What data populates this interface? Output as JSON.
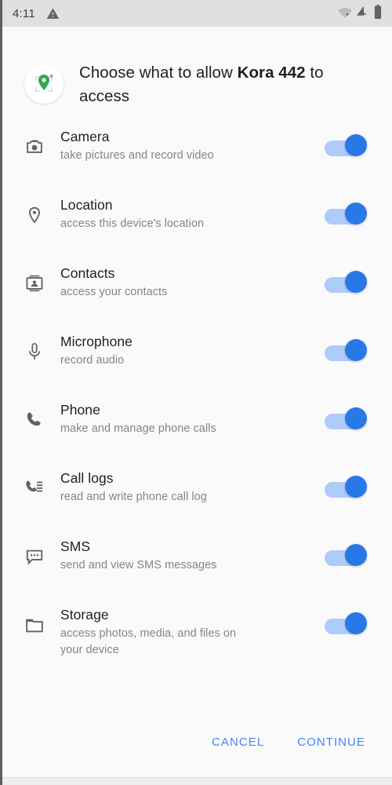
{
  "status_bar": {
    "time": "4:11",
    "warning_icon": "warning-triangle-icon",
    "wifi_icon": "wifi-disconnected-icon",
    "cellular_icon": "cellular-signal-no-sim-icon",
    "battery_icon": "battery-full-icon"
  },
  "header": {
    "app_icon": "location-scanner-app-icon",
    "title_prefix": "Choose what to allow ",
    "app_name": "Kora 442",
    "title_suffix": " to access"
  },
  "permissions": [
    {
      "icon": "camera-icon",
      "title": "Camera",
      "description": "take pictures and record video",
      "enabled": true
    },
    {
      "icon": "location-pin-icon",
      "title": "Location",
      "description": "access this device's location",
      "enabled": true
    },
    {
      "icon": "contacts-icon",
      "title": "Contacts",
      "description": "access your contacts",
      "enabled": true
    },
    {
      "icon": "microphone-icon",
      "title": "Microphone",
      "description": "record audio",
      "enabled": true
    },
    {
      "icon": "phone-icon",
      "title": "Phone",
      "description": "make and manage phone calls",
      "enabled": true
    },
    {
      "icon": "call-logs-icon",
      "title": "Call logs",
      "description": "read and write phone call log",
      "enabled": true
    },
    {
      "icon": "sms-icon",
      "title": "SMS",
      "description": "send and view SMS messages",
      "enabled": true
    },
    {
      "icon": "folder-icon",
      "title": "Storage",
      "description": "access photos, media, and files on your device",
      "enabled": true
    }
  ],
  "actions": {
    "cancel_label": "CANCEL",
    "continue_label": "CONTINUE"
  },
  "colors": {
    "accent": "#4285f4",
    "toggle_thumb": "#2878e8",
    "toggle_track": "#aecbfa",
    "title_text": "#202124",
    "description_text": "#80868b",
    "statusbar_bg": "#e0e0e0",
    "dialog_bg": "#fafafa",
    "app_icon_pin": "#34a853"
  }
}
